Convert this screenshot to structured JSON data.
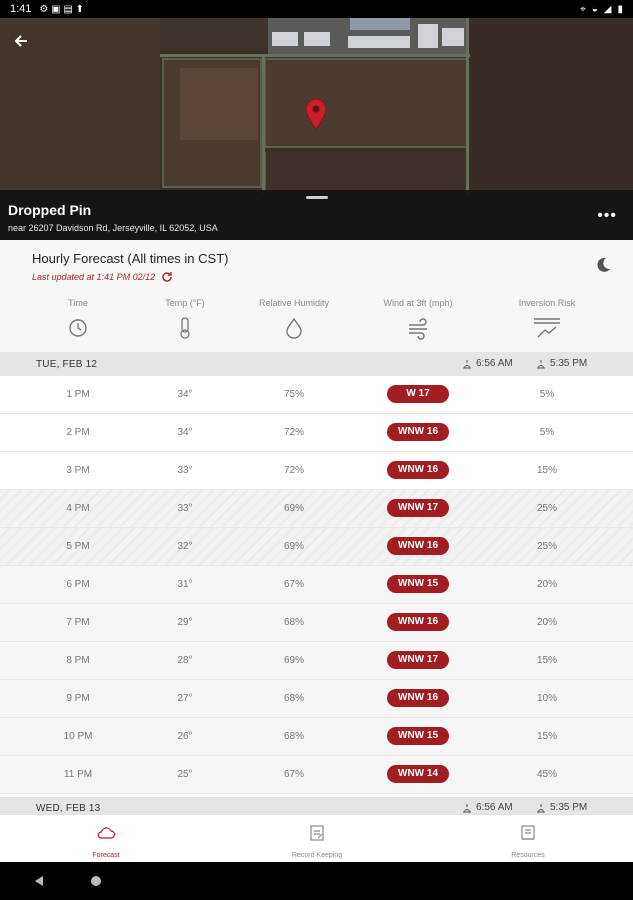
{
  "status_bar": {
    "time": "1:41"
  },
  "location": {
    "title": "Dropped Pin",
    "address": "near 26207 Davidson Rd, Jerseyville, IL 62052, USA"
  },
  "forecast": {
    "title": "Hourly Forecast (All times in CST)",
    "updated": "Last updated at 1:41 PM 02/12",
    "columns": [
      "Time",
      "Temp (°F)",
      "Relative Humidity",
      "Wind at 3ft (mph)",
      "Inversion Risk"
    ]
  },
  "days": [
    {
      "label": "TUE, FEB 12",
      "sunrise": "6:56 AM",
      "sunset": "5:35 PM"
    },
    {
      "label": "WED, FEB 13",
      "sunrise": "6:56 AM",
      "sunset": "5:35 PM"
    }
  ],
  "rows": [
    {
      "time": "1 PM",
      "temp": "34°",
      "humidity": "75%",
      "wind": "W 17",
      "inversion": "5%"
    },
    {
      "time": "2 PM",
      "temp": "34°",
      "humidity": "72%",
      "wind": "WNW 16",
      "inversion": "5%"
    },
    {
      "time": "3 PM",
      "temp": "33°",
      "humidity": "72%",
      "wind": "WNW 16",
      "inversion": "15%"
    },
    {
      "time": "4 PM",
      "temp": "33°",
      "humidity": "69%",
      "wind": "WNW 17",
      "inversion": "25%"
    },
    {
      "time": "5 PM",
      "temp": "32°",
      "humidity": "69%",
      "wind": "WNW 16",
      "inversion": "25%"
    },
    {
      "time": "6 PM",
      "temp": "31°",
      "humidity": "67%",
      "wind": "WNW 15",
      "inversion": "20%"
    },
    {
      "time": "7 PM",
      "temp": "29°",
      "humidity": "68%",
      "wind": "WNW 16",
      "inversion": "20%"
    },
    {
      "time": "8 PM",
      "temp": "28°",
      "humidity": "69%",
      "wind": "WNW 17",
      "inversion": "15%"
    },
    {
      "time": "9 PM",
      "temp": "27°",
      "humidity": "68%",
      "wind": "WNW 16",
      "inversion": "10%"
    },
    {
      "time": "10 PM",
      "temp": "26°",
      "humidity": "68%",
      "wind": "WNW 15",
      "inversion": "15%"
    },
    {
      "time": "11 PM",
      "temp": "25°",
      "humidity": "67%",
      "wind": "WNW 14",
      "inversion": "45%"
    }
  ],
  "nav": {
    "forecast": "Forecast",
    "record_keeping": "Record Keeping",
    "resources": "Resources"
  },
  "colors": {
    "accent": "#a11d22",
    "wind_badge": "#a11d22"
  },
  "icons": [
    "back-arrow-icon",
    "map-pin-icon",
    "more-icon",
    "refresh-icon",
    "moon-icon",
    "clock-icon",
    "thermometer-icon",
    "droplet-icon",
    "wind-icon",
    "inversion-icon",
    "sunrise-icon",
    "sunset-icon",
    "cloud-icon",
    "notebook-icon",
    "book-icon"
  ]
}
